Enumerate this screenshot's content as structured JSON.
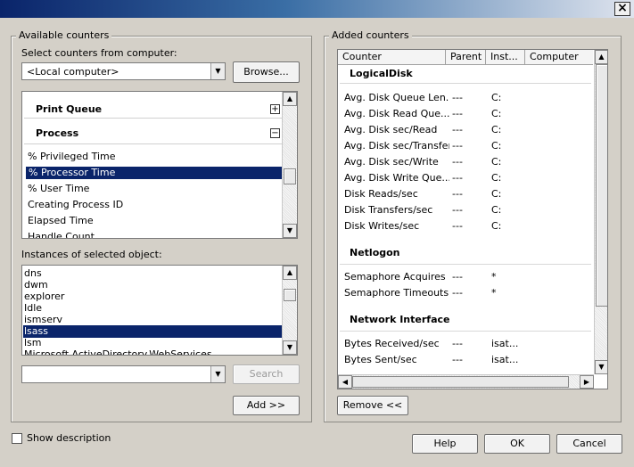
{
  "dialog": {
    "close_glyph": "×",
    "available_title": "Available counters",
    "select_from_label": "Select counters from computer:",
    "computer_value": "<Local computer>",
    "browse_label": "Browse...",
    "objects": [
      {
        "name": "Print Queue",
        "toggle": "+"
      },
      {
        "name": "Process",
        "toggle": "−"
      }
    ],
    "counters": [
      "% Privileged Time",
      "% Processor Time",
      "% User Time",
      "Creating Process ID",
      "Elapsed Time",
      "Handle Count"
    ],
    "instances_label": "Instances of selected object:",
    "instances": [
      "dns",
      "dwm",
      "explorer",
      "Idle",
      "ismserv",
      "lsass",
      "lsm",
      "Microsoft.ActiveDirectory.WebServices"
    ],
    "search_value": "",
    "search_label": "Search",
    "add_label": "Add >>",
    "added_title": "Added counters",
    "columns": [
      "Counter",
      "Parent",
      "Inst...",
      "Computer"
    ],
    "groups": [
      {
        "name": "LogicalDisk",
        "rows": [
          {
            "counter": "Avg. Disk Queue Len...",
            "parent": "---",
            "inst": "C:"
          },
          {
            "counter": "Avg. Disk Read Que...",
            "parent": "---",
            "inst": "C:"
          },
          {
            "counter": "Avg. Disk sec/Read",
            "parent": "---",
            "inst": "C:"
          },
          {
            "counter": "Avg. Disk sec/Transfer",
            "parent": "---",
            "inst": "C:"
          },
          {
            "counter": "Avg. Disk sec/Write",
            "parent": "---",
            "inst": "C:"
          },
          {
            "counter": "Avg. Disk Write Que...",
            "parent": "---",
            "inst": "C:"
          },
          {
            "counter": "Disk Reads/sec",
            "parent": "---",
            "inst": "C:"
          },
          {
            "counter": "Disk Transfers/sec",
            "parent": "---",
            "inst": "C:"
          },
          {
            "counter": "Disk Writes/sec",
            "parent": "---",
            "inst": "C:"
          }
        ]
      },
      {
        "name": "Netlogon",
        "rows": [
          {
            "counter": "Semaphore Acquires",
            "parent": "---",
            "inst": "*"
          },
          {
            "counter": "Semaphore Timeouts",
            "parent": "---",
            "inst": "*"
          }
        ]
      },
      {
        "name": "Network Interface",
        "rows": [
          {
            "counter": "Bytes Received/sec",
            "parent": "---",
            "inst": "isat..."
          },
          {
            "counter": "Bytes Sent/sec",
            "parent": "---",
            "inst": "isat..."
          }
        ]
      }
    ],
    "remove_label": "Remove <<",
    "show_description_label": "Show description",
    "help_label": "Help",
    "ok_label": "OK",
    "cancel_label": "Cancel"
  }
}
